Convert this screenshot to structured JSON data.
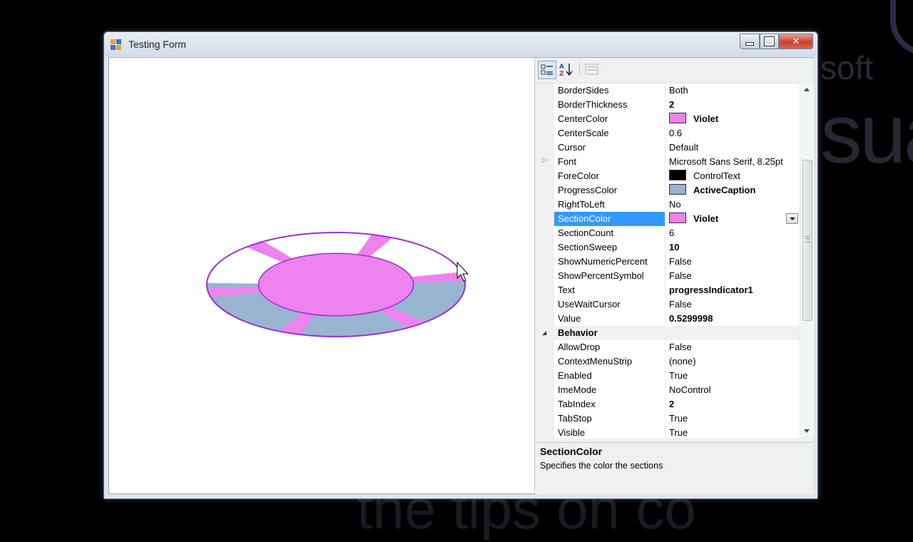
{
  "window": {
    "title": "Testing Form"
  },
  "background": {
    "line1": "soft",
    "line2": "sua",
    "line3": "the tips on co"
  },
  "progress_indicator": {
    "center_color": "#ee82ee",
    "section_color": "#ee82ee",
    "progress_color": "#99b4d1",
    "border_color": "#9932cc",
    "section_count": 6,
    "section_sweep": 10,
    "center_scale": 0.6,
    "value": 0.5299998
  },
  "toolbar": {
    "categorized": "categorized-icon",
    "alphabetical": "alphabetical-icon",
    "pages": "property-pages-icon"
  },
  "properties": [
    {
      "name": "BorderSides",
      "value": "Both"
    },
    {
      "name": "BorderThickness",
      "value": "2",
      "bold": true
    },
    {
      "name": "CenterColor",
      "value": "Violet",
      "bold": true,
      "swatch": "#ee82ee"
    },
    {
      "name": "CenterScale",
      "value": "0.6"
    },
    {
      "name": "Cursor",
      "value": "Default"
    },
    {
      "name": "Font",
      "value": "Microsoft Sans Serif, 8.25pt",
      "expandable": true
    },
    {
      "name": "ForeColor",
      "value": "ControlText",
      "swatch": "#000000"
    },
    {
      "name": "ProgressColor",
      "value": "ActiveCaption",
      "bold": true,
      "swatch": "#99b4d1"
    },
    {
      "name": "RightToLeft",
      "value": "No"
    },
    {
      "name": "SectionColor",
      "value": "Violet",
      "bold": true,
      "swatch": "#ee82ee",
      "selected": true
    },
    {
      "name": "SectionCount",
      "value": "6"
    },
    {
      "name": "SectionSweep",
      "value": "10",
      "bold": true
    },
    {
      "name": "ShowNumericPercent",
      "value": "False"
    },
    {
      "name": "ShowPercentSymbol",
      "value": "False"
    },
    {
      "name": "Text",
      "value": "progressIndicator1",
      "bold": true
    },
    {
      "name": "UseWaitCursor",
      "value": "False"
    },
    {
      "name": "Value",
      "value": "0.5299998",
      "bold": true
    },
    {
      "name": "Behavior",
      "category": true
    },
    {
      "name": "AllowDrop",
      "value": "False"
    },
    {
      "name": "ContextMenuStrip",
      "value": "(none)"
    },
    {
      "name": "Enabled",
      "value": "True"
    },
    {
      "name": "ImeMode",
      "value": "NoControl"
    },
    {
      "name": "TabIndex",
      "value": "2",
      "bold": true
    },
    {
      "name": "TabStop",
      "value": "True"
    },
    {
      "name": "Visible",
      "value": "True"
    }
  ],
  "help": {
    "title": "SectionColor",
    "description": "Specifies the color the sections"
  }
}
